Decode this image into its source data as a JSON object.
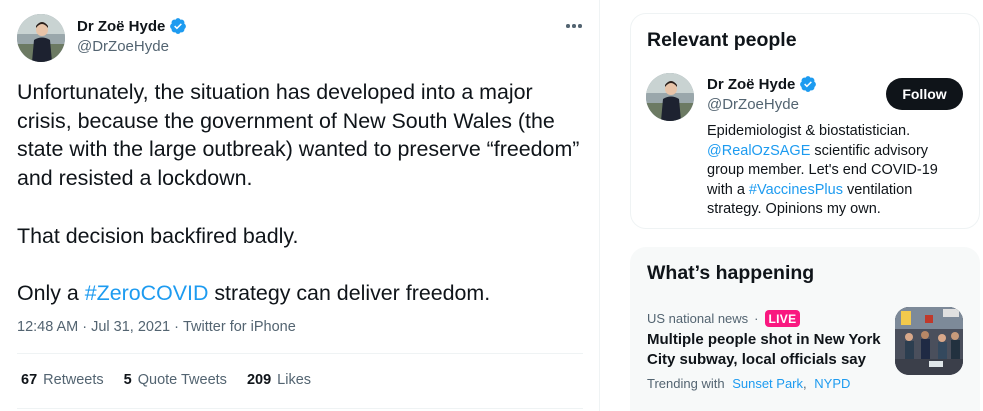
{
  "tweet": {
    "author": {
      "name": "Dr Zoë Hyde",
      "handle": "@DrZoeHyde",
      "avatar_icon": "profile-photo",
      "verified_icon": "verified-badge-icon"
    },
    "more_icon": "more-options-icon",
    "text": {
      "para1": "Unfortunately, the situation has developed into a major crisis, because the government of New South Wales (the state with the large outbreak) wanted to preserve “freedom” and resisted a lockdown.",
      "para2": "That decision backfired badly.",
      "para3_before": "Only a ",
      "hashtag": "#ZeroCOVID",
      "para3_after": " strategy can deliver freedom."
    },
    "time": "12:48 AM",
    "date": "Jul 31, 2021",
    "separator": "·",
    "source": "Twitter for iPhone",
    "stats": {
      "retweets_count": "67",
      "retweets_label": "Retweets",
      "quotes_count": "5",
      "quotes_label": "Quote Tweets",
      "likes_count": "209",
      "likes_label": "Likes"
    }
  },
  "sidebar": {
    "relevant_people": {
      "title": "Relevant people",
      "person": {
        "name": "Dr Zoë Hyde",
        "handle": "@DrZoeHyde",
        "follow_label": "Follow",
        "bio_1": "Epidemiologist & biostatistician. ",
        "bio_mention": "@RealOzSAGE",
        "bio_2": " scientific advisory group member. Let's end COVID-19 with a ",
        "bio_hashtag": "#VaccinesPlus",
        "bio_3": " ventilation strategy. Opinions my own."
      }
    },
    "whats_happening": {
      "title": "What’s happening",
      "trend": {
        "category": "US national news",
        "separator": "·",
        "live_badge": "LIVE",
        "headline": "Multiple people shot in New York City subway, local officials say",
        "trending_with_label": "Trending with",
        "topics": [
          "Sunset Park",
          "NYPD"
        ]
      }
    }
  },
  "colors": {
    "accent": "#1d9bf0",
    "text": "#0f1419",
    "secondary": "#536471",
    "live": "#f91880",
    "follow_bg": "#0f1419"
  }
}
